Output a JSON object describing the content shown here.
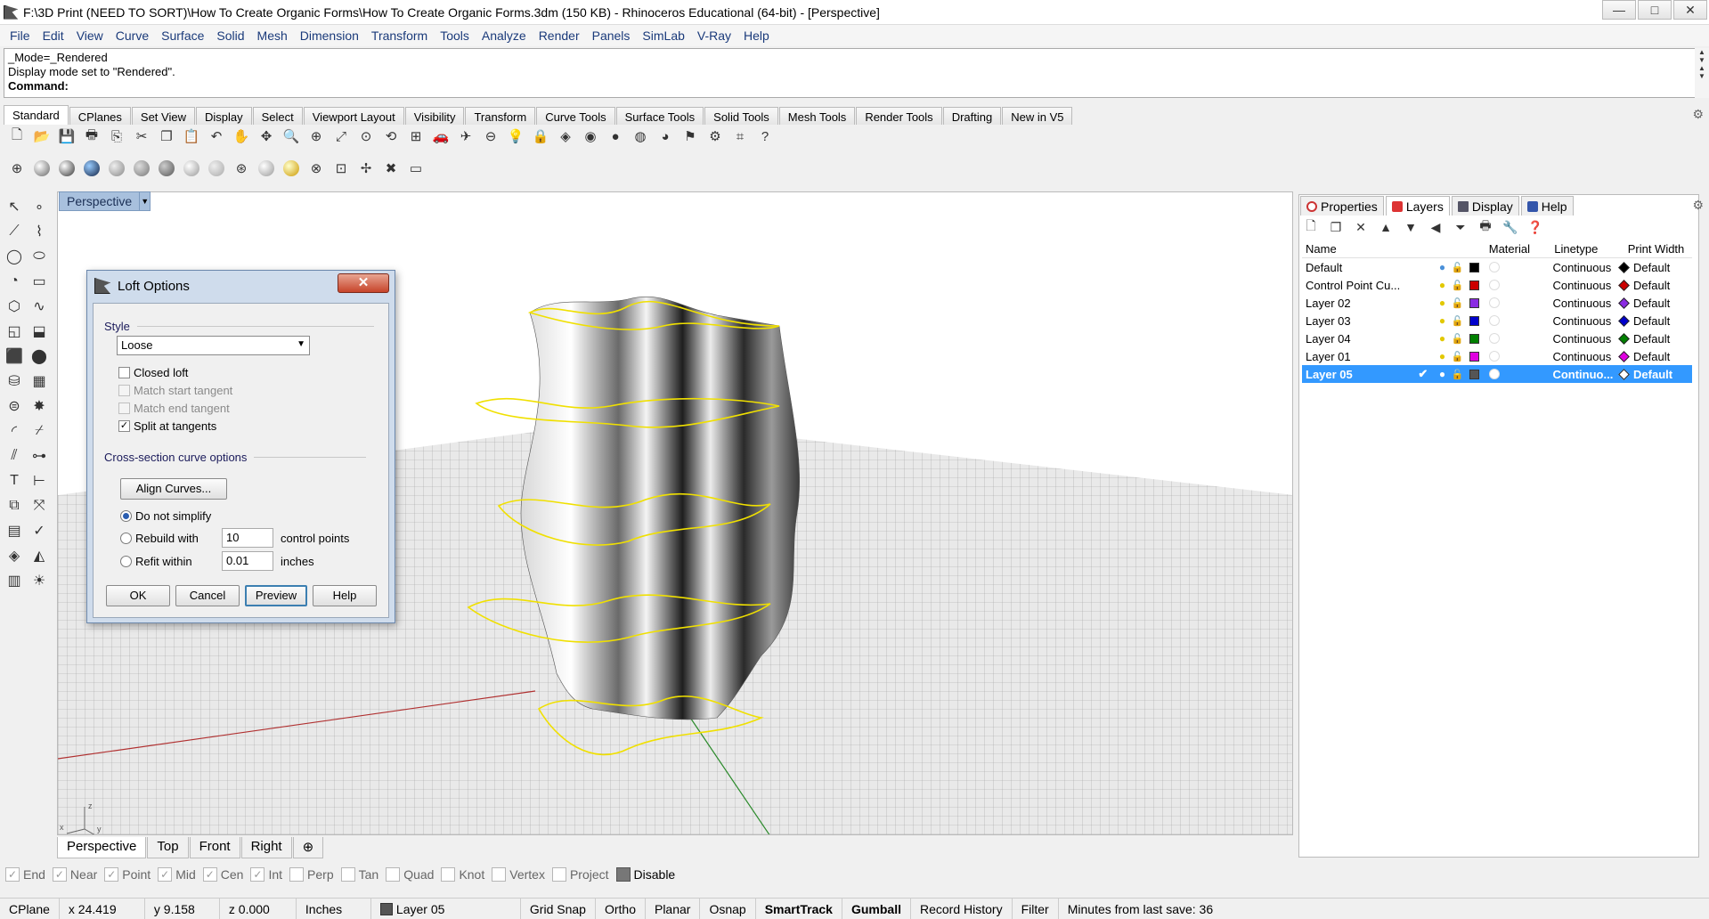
{
  "window": {
    "title": "F:\\3D Print (NEED TO SORT)\\How To Create Organic Forms\\How To Create Organic Forms.3dm (150 KB) - Rhinoceros Educational (64-bit) - [Perspective]",
    "controls": [
      "—",
      "□",
      "✕"
    ]
  },
  "menu": [
    "File",
    "Edit",
    "View",
    "Curve",
    "Surface",
    "Solid",
    "Mesh",
    "Dimension",
    "Transform",
    "Tools",
    "Analyze",
    "Render",
    "Panels",
    "SimLab",
    "V-Ray",
    "Help"
  ],
  "command": {
    "history1": "_Mode=_Rendered",
    "history2": "Display mode set to \"Rendered\".",
    "prompt": "Command:"
  },
  "toolbar_tabs": [
    "Standard",
    "CPlanes",
    "Set View",
    "Display",
    "Select",
    "Viewport Layout",
    "Visibility",
    "Transform",
    "Curve Tools",
    "Surface Tools",
    "Solid Tools",
    "Mesh Tools",
    "Render Tools",
    "Drafting",
    "New in V5"
  ],
  "toolbar_row1": [
    "new-document-icon",
    "open-folder-icon",
    "save-icon",
    "print-icon",
    "import-icon",
    "cut-icon",
    "copy-icon",
    "paste-icon",
    "undo-icon",
    "pan-hand-icon",
    "move-view-icon",
    "zoom-icon",
    "zoom-window-icon",
    "zoom-extents-icon",
    "zoom-selected-icon",
    "rotate-view-icon",
    "four-viewports-icon",
    "car-icon",
    "spaceship-icon",
    "cplane-icon",
    "light-bulb-icon",
    "lock-icon",
    "layer-icon",
    "color-wheel-icon",
    "render-sphere-icon",
    "material-sphere-icon",
    "environment-sphere-icon",
    "spotlight-icon",
    "settings-gears-icon",
    "grid-snap-icon",
    "help-icon"
  ],
  "toolbar_row2": [
    "wireframe-sphere-icon",
    "shaded-sphere-icon",
    "rendered-sphere-icon",
    "ghosted-sphere-icon",
    "xray-sphere-icon",
    "technical-sphere-icon",
    "artistic-sphere-icon",
    "pen-sphere-icon",
    "other-sphere-icon",
    "globe-icon",
    "gray-sphere-icon",
    "yellow-sphere-icon",
    "target-icon",
    "capture-icon",
    "move-arrows-icon",
    "delete-red-icon",
    "monitor-icon"
  ],
  "viewport": {
    "title": "Perspective",
    "tabs": [
      "Perspective",
      "Top",
      "Front",
      "Right",
      "⊕"
    ],
    "axis_labels": [
      "z",
      "x",
      "y"
    ]
  },
  "osnap": [
    {
      "label": "End",
      "checked": true
    },
    {
      "label": "Near",
      "checked": true
    },
    {
      "label": "Point",
      "checked": true
    },
    {
      "label": "Mid",
      "checked": true
    },
    {
      "label": "Cen",
      "checked": true
    },
    {
      "label": "Int",
      "checked": true
    },
    {
      "label": "Perp",
      "checked": false
    },
    {
      "label": "Tan",
      "checked": false
    },
    {
      "label": "Quad",
      "checked": false
    },
    {
      "label": "Knot",
      "checked": false
    },
    {
      "label": "Vertex",
      "checked": false
    },
    {
      "label": "Project",
      "checked": false
    },
    {
      "label": "Disable",
      "checked": false
    }
  ],
  "status": {
    "cplane": "CPlane",
    "x": "x 24.419",
    "y": "y 9.158",
    "z": "z 0.000",
    "units": "Inches",
    "layer": "Layer 05",
    "grid_snap": "Grid Snap",
    "ortho": "Ortho",
    "planar": "Planar",
    "osnap": "Osnap",
    "smarttrack": "SmartTrack",
    "gumball": "Gumball",
    "record_history": "Record History",
    "filter": "Filter",
    "minutes": "Minutes from last save: 36"
  },
  "panel": {
    "tabs": [
      "Properties",
      "Layers",
      "Display",
      "Help"
    ],
    "tool_icons": [
      "new-layer-icon",
      "new-sublayer-icon",
      "delete-layer-icon",
      "move-up-icon",
      "move-down-icon",
      "move-left-icon",
      "filter-icon",
      "print-layer-icon",
      "wrench-icon",
      "help-circle-icon"
    ],
    "headers": {
      "name": "Name",
      "material": "Material",
      "linetype": "Linetype",
      "print_width": "Print Width"
    },
    "layers": [
      {
        "name": "Default",
        "current": "",
        "bulb": "#4a90d9",
        "color": "#000000",
        "linetype": "Continuous",
        "print_width": "Default",
        "pw_color": "#000000"
      },
      {
        "name": "Control Point Cu...",
        "current": "",
        "bulb": "#e2c800",
        "color": "#cc0000",
        "linetype": "Continuous",
        "print_width": "Default",
        "pw_color": "#cc0000"
      },
      {
        "name": "Layer 02",
        "current": "",
        "bulb": "#e2c800",
        "color": "#8a2be2",
        "linetype": "Continuous",
        "print_width": "Default",
        "pw_color": "#8a2be2"
      },
      {
        "name": "Layer 03",
        "current": "",
        "bulb": "#e2c800",
        "color": "#0000cc",
        "linetype": "Continuous",
        "print_width": "Default",
        "pw_color": "#0000cc"
      },
      {
        "name": "Layer 04",
        "current": "",
        "bulb": "#e2c800",
        "color": "#008000",
        "linetype": "Continuous",
        "print_width": "Default",
        "pw_color": "#008000"
      },
      {
        "name": "Layer 01",
        "current": "",
        "bulb": "#e2c800",
        "color": "#e000e0",
        "linetype": "Continuous",
        "print_width": "Default",
        "pw_color": "#e000e0"
      },
      {
        "name": "Layer 05",
        "current": "✔",
        "bulb": "#ffffff",
        "color": "#555555",
        "linetype": "Continuo...",
        "print_width": "Default",
        "pw_color": "#ffffff"
      }
    ]
  },
  "dialog": {
    "title": "Loft Options",
    "close": "✕",
    "style_label": "Style",
    "style_value": "Loose",
    "closed_loft": "Closed loft",
    "match_start": "Match start tangent",
    "match_end": "Match end tangent",
    "split": "Split at tangents",
    "cross_label": "Cross-section curve options",
    "align": "Align Curves...",
    "do_not_simplify": "Do not simplify",
    "rebuild_with": "Rebuild with",
    "rebuild_value": "10",
    "rebuild_unit": "control points",
    "refit_within": "Refit within",
    "refit_value": "0.01",
    "refit_unit": "inches",
    "ok": "OK",
    "cancel": "Cancel",
    "preview": "Preview",
    "help": "Help"
  }
}
